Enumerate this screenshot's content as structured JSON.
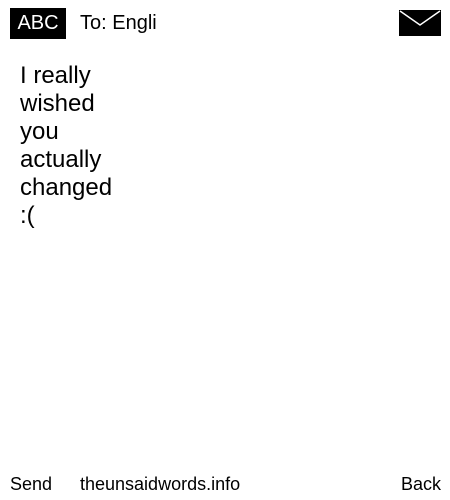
{
  "header": {
    "input_mode": "ABC",
    "recipient": "To: Engli",
    "icon": "envelope-icon"
  },
  "message": {
    "lines": [
      "I really",
      "wished",
      "you",
      "actually",
      "changed",
      ":("
    ]
  },
  "footer": {
    "send_label": "Send",
    "site_label": "theunsaidwords.info",
    "back_label": "Back"
  },
  "colors": {
    "background": "#ffffff",
    "text": "#000000",
    "badge_background": "#000000",
    "badge_text": "#ffffff"
  }
}
